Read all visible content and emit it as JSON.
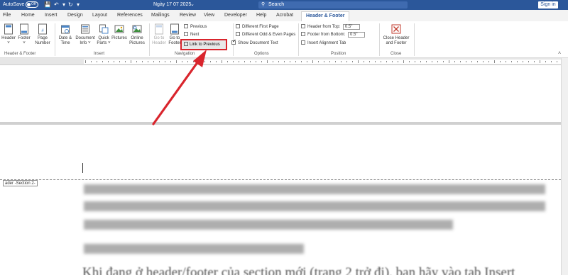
{
  "titlebar": {
    "autosave_label": "AutoSave",
    "autosave_state": "Off",
    "doc_title": "Ngày 17 07 2025",
    "search_placeholder": "Search",
    "signin_label": "Sign in",
    "qat_icons": [
      "save-icon",
      "undo-icon",
      "redo-icon",
      "customize-icon"
    ]
  },
  "tabs": [
    "File",
    "Home",
    "Insert",
    "Design",
    "Layout",
    "References",
    "Mailings",
    "Review",
    "View",
    "Developer",
    "Help",
    "Acrobat",
    "Header & Footer"
  ],
  "ribbon": {
    "header_footer_group": {
      "label": "Header & Footer",
      "header": "Header",
      "footer": "Footer",
      "page_number_1": "Page",
      "page_number_2": "Number"
    },
    "insert_group": {
      "label": "Insert",
      "date_time_1": "Date &",
      "date_time_2": "Time",
      "doc_info_1": "Document",
      "doc_info_2": "Info",
      "quick_parts_1": "Quick",
      "quick_parts_2": "Parts",
      "pictures": "Pictures",
      "online_pictures_1": "Online",
      "online_pictures_2": "Pictures"
    },
    "navigation_group": {
      "label": "Navigation",
      "goto_header_1": "Go to",
      "goto_header_2": "Header",
      "goto_footer_1": "Go to",
      "goto_footer_2": "Footer",
      "previous": "Previous",
      "next": "Next",
      "link_to_previous": "Link to Previous"
    },
    "options_group": {
      "label": "Options",
      "different_first_page": "Different First Page",
      "different_odd_even": "Different Odd & Even Pages",
      "show_document_text": "Show Document Text"
    },
    "position_group": {
      "label": "Position",
      "header_from_top": "Header from Top:",
      "header_from_top_value": "0.5\"",
      "footer_from_bottom": "Footer from Bottom:",
      "footer_from_bottom_value": "0.5\"",
      "insert_alignment_tab": "Insert Alignment Tab"
    },
    "close_group": {
      "label": "Close",
      "close_1": "Close Header",
      "close_2": "and Footer"
    }
  },
  "document": {
    "section_label": "ader -Section 2-",
    "visible_text": "Khi đang ở header/footer của section mới (trang 2 trở đi), bạn hãy vào tab Insert"
  },
  "colors": {
    "title_bar": "#2b579a",
    "highlight": "#d9252d"
  }
}
